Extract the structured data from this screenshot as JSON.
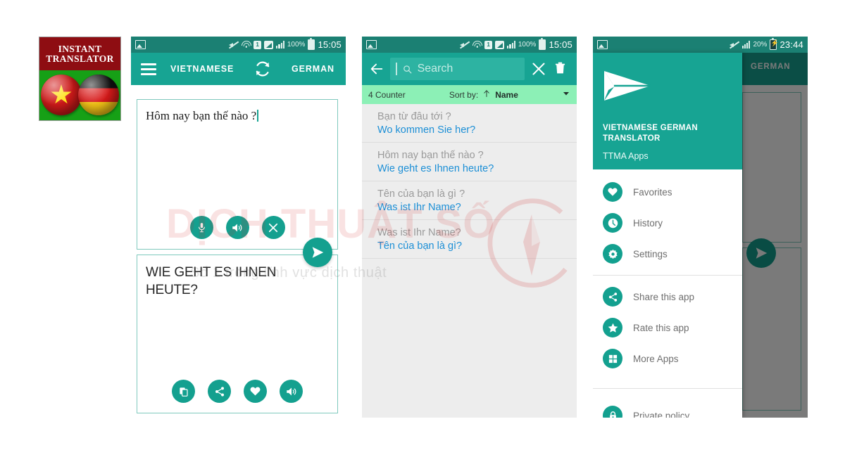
{
  "app_icon": {
    "line1": "INSTANT",
    "line2": "TRANSLATOR",
    "flag_left": "vietnam-flag",
    "flag_right": "germany-flag"
  },
  "watermark": {
    "main": "DỊCH THUẬT SỐ",
    "sub": "Số 1 trong lĩnh vực dịch thuật",
    "color": "#d02828"
  },
  "theme": {
    "primary": "#17a493",
    "primary_dark": "#1b8073",
    "accent_green": "#8cf0b6",
    "link_blue": "#1c8fd6",
    "list_bg": "#ededed"
  },
  "phone1": {
    "status": {
      "photo_icon": "photo-icon",
      "mute_icon": "mute-icon",
      "wifi_icon": "wifi-icon",
      "sim_icon": "1",
      "signal_box_icon": "signal-box-icon",
      "signal_icon": "signal-bars-icon",
      "battery_pct": "100%",
      "battery_icon": "battery-icon",
      "time": "15:05"
    },
    "appbar": {
      "menu_icon": "hamburger-icon",
      "source_lang": "VIETNAMESE",
      "swap_icon": "swap-refresh-icon",
      "target_lang": "GERMAN"
    },
    "input_card": {
      "text": "Hôm nay bạn thế nào ?",
      "actions": [
        {
          "name": "mic-button",
          "icon": "microphone-icon"
        },
        {
          "name": "speak-button",
          "icon": "speaker-icon"
        },
        {
          "name": "clear-button",
          "icon": "close-x-icon"
        }
      ]
    },
    "send_button": {
      "icon": "send-paper-plane-icon"
    },
    "output_card": {
      "text": "WIE GEHT ES IHNEN HEUTE?",
      "actions": [
        {
          "name": "copy-button",
          "icon": "copy-icon"
        },
        {
          "name": "share-button",
          "icon": "share-icon"
        },
        {
          "name": "favorite-button",
          "icon": "heart-icon"
        },
        {
          "name": "speak-button",
          "icon": "speaker-icon"
        }
      ]
    }
  },
  "phone2": {
    "status": {
      "battery_pct": "100%",
      "time": "15:05"
    },
    "searchbar": {
      "back_icon": "back-arrow-icon",
      "search_placeholder": "Search",
      "search_value": "",
      "clear_icon": "close-x-icon",
      "delete_icon": "trash-icon"
    },
    "sortbar": {
      "counter": "4 Counter",
      "sort_label": "Sort by:",
      "sort_direction_icon": "arrow-up-icon",
      "sort_value": "Name",
      "dropdown_icon": "chevron-down-icon"
    },
    "items": [
      {
        "source": "Bạn từ đâu tới ?",
        "target": "Wo kommen Sie her?"
      },
      {
        "source": "Hôm nay bạn thế nào ?",
        "target": "Wie geht es Ihnen heute?"
      },
      {
        "source": "Tên của bạn là gì ?",
        "target": "Was ist Ihr Name?"
      },
      {
        "source": "Was ist Ihr Name?",
        "target": "Tên của bạn là gì?"
      }
    ]
  },
  "phone3": {
    "status": {
      "mute_icon": "mute-icon",
      "signal_icon": "signal-bars-icon",
      "battery_pct": "20%",
      "battery_icon": "battery-charging-icon",
      "time": "23:44"
    },
    "drawer": {
      "logo_icon": "paper-plane-logo",
      "title": "VIETNAMESE GERMAN TRANSLATOR",
      "subtitle": "TTMA Apps",
      "items": [
        {
          "label": "Favorites",
          "icon": "heart-icon"
        },
        {
          "label": "History",
          "icon": "clock-icon"
        },
        {
          "label": "Settings",
          "icon": "gear-icon"
        },
        {
          "label": "Share this app",
          "icon": "share-icon"
        },
        {
          "label": "Rate this app",
          "icon": "star-icon"
        },
        {
          "label": "More Apps",
          "icon": "grid-apps-icon"
        },
        {
          "label": "Private policy",
          "icon": "lock-icon"
        }
      ]
    },
    "behind": {
      "target_lang": "GERMAN",
      "send_icon": "send-paper-plane-icon"
    }
  }
}
